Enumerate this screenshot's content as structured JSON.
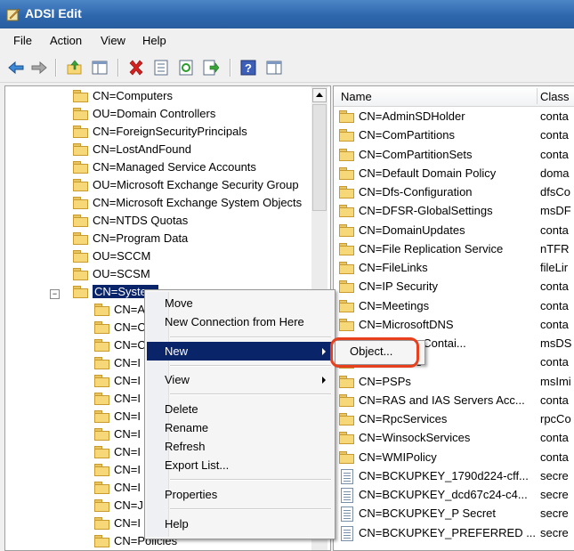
{
  "window": {
    "title": "ADSI Edit"
  },
  "menubar": {
    "items": [
      "File",
      "Action",
      "View",
      "Help"
    ]
  },
  "toolbar": {
    "icons": [
      "back-arrow-icon",
      "forward-arrow-icon",
      "up-folder-icon",
      "show-hide-tree-icon",
      "delete-icon",
      "properties-icon",
      "refresh-icon",
      "export-icon",
      "help-icon",
      "console-tree-icon"
    ]
  },
  "tree": {
    "items": [
      {
        "label": "CN=Computers"
      },
      {
        "label": "OU=Domain Controllers"
      },
      {
        "label": "CN=ForeignSecurityPrincipals"
      },
      {
        "label": "CN=LostAndFound"
      },
      {
        "label": "CN=Managed Service Accounts"
      },
      {
        "label": "OU=Microsoft Exchange Security Group"
      },
      {
        "label": "CN=Microsoft Exchange System Objects"
      },
      {
        "label": "CN=NTDS Quotas"
      },
      {
        "label": "CN=Program Data"
      },
      {
        "label": "OU=SCCM"
      },
      {
        "label": "OU=SCSM"
      },
      {
        "label": "CN=System"
      }
    ],
    "children": [
      "CN=A",
      "CN=C",
      "CN=C",
      "CN=I",
      "CN=I",
      "CN=I",
      "CN=I",
      "CN=I",
      "CN=I",
      "CN=I",
      "CN=I",
      "CN=J",
      "CN=I",
      "CN=I",
      "CN=I"
    ],
    "last_child": "CN=Policies",
    "expander": "−"
  },
  "list": {
    "columns": [
      "Name",
      "Class"
    ],
    "rows": [
      {
        "name": "CN=AdminSDHolder",
        "cls": "conta"
      },
      {
        "name": "CN=ComPartitions",
        "cls": "conta"
      },
      {
        "name": "CN=ComPartitionSets",
        "cls": "conta"
      },
      {
        "name": "CN=Default Domain Policy",
        "cls": "doma"
      },
      {
        "name": "CN=Dfs-Configuration",
        "cls": "dfsCo"
      },
      {
        "name": "CN=DFSR-GlobalSettings",
        "cls": "msDF"
      },
      {
        "name": "CN=DomainUpdates",
        "cls": "conta"
      },
      {
        "name": "CN=File Replication Service",
        "cls": "nTFR"
      },
      {
        "name": "CN=FileLinks",
        "cls": "fileLir"
      },
      {
        "name": "CN=IP Security",
        "cls": "conta"
      },
      {
        "name": "CN=Meetings",
        "cls": "conta"
      },
      {
        "name": "CN=MicrosoftDNS",
        "cls": "conta"
      },
      {
        "name": "...d Settings Contai...",
        "cls": "msDS"
      },
      {
        "name": "CN=Policies",
        "cls": "conta"
      },
      {
        "name": "CN=PSPs",
        "cls": "msImi"
      },
      {
        "name": "CN=RAS and IAS Servers Acc...",
        "cls": "conta"
      },
      {
        "name": "CN=RpcServices",
        "cls": "rpcCo"
      },
      {
        "name": "CN=WinsockServices",
        "cls": "conta"
      },
      {
        "name": "CN=WMIPolicy",
        "cls": "conta"
      },
      {
        "name": "CN=BCKUPKEY_1790d224-cff...",
        "cls": "secre"
      },
      {
        "name": "CN=BCKUPKEY_dcd67c24-c4...",
        "cls": "secre"
      },
      {
        "name": "CN=BCKUPKEY_P Secret",
        "cls": "secre"
      },
      {
        "name": "CN=BCKUPKEY_PREFERRED ...",
        "cls": "secre"
      }
    ]
  },
  "context_menu": {
    "move": "Move",
    "new_connection": "New Connection from Here",
    "new": "New",
    "view": "View",
    "delete": "Delete",
    "rename": "Rename",
    "refresh": "Refresh",
    "export_list": "Export List...",
    "properties": "Properties",
    "help": "Help"
  },
  "submenu": {
    "object": "Object..."
  },
  "colors": {
    "selection": "#0a246a",
    "callout": "#e8401e",
    "titlebar": "#2e67ad"
  }
}
